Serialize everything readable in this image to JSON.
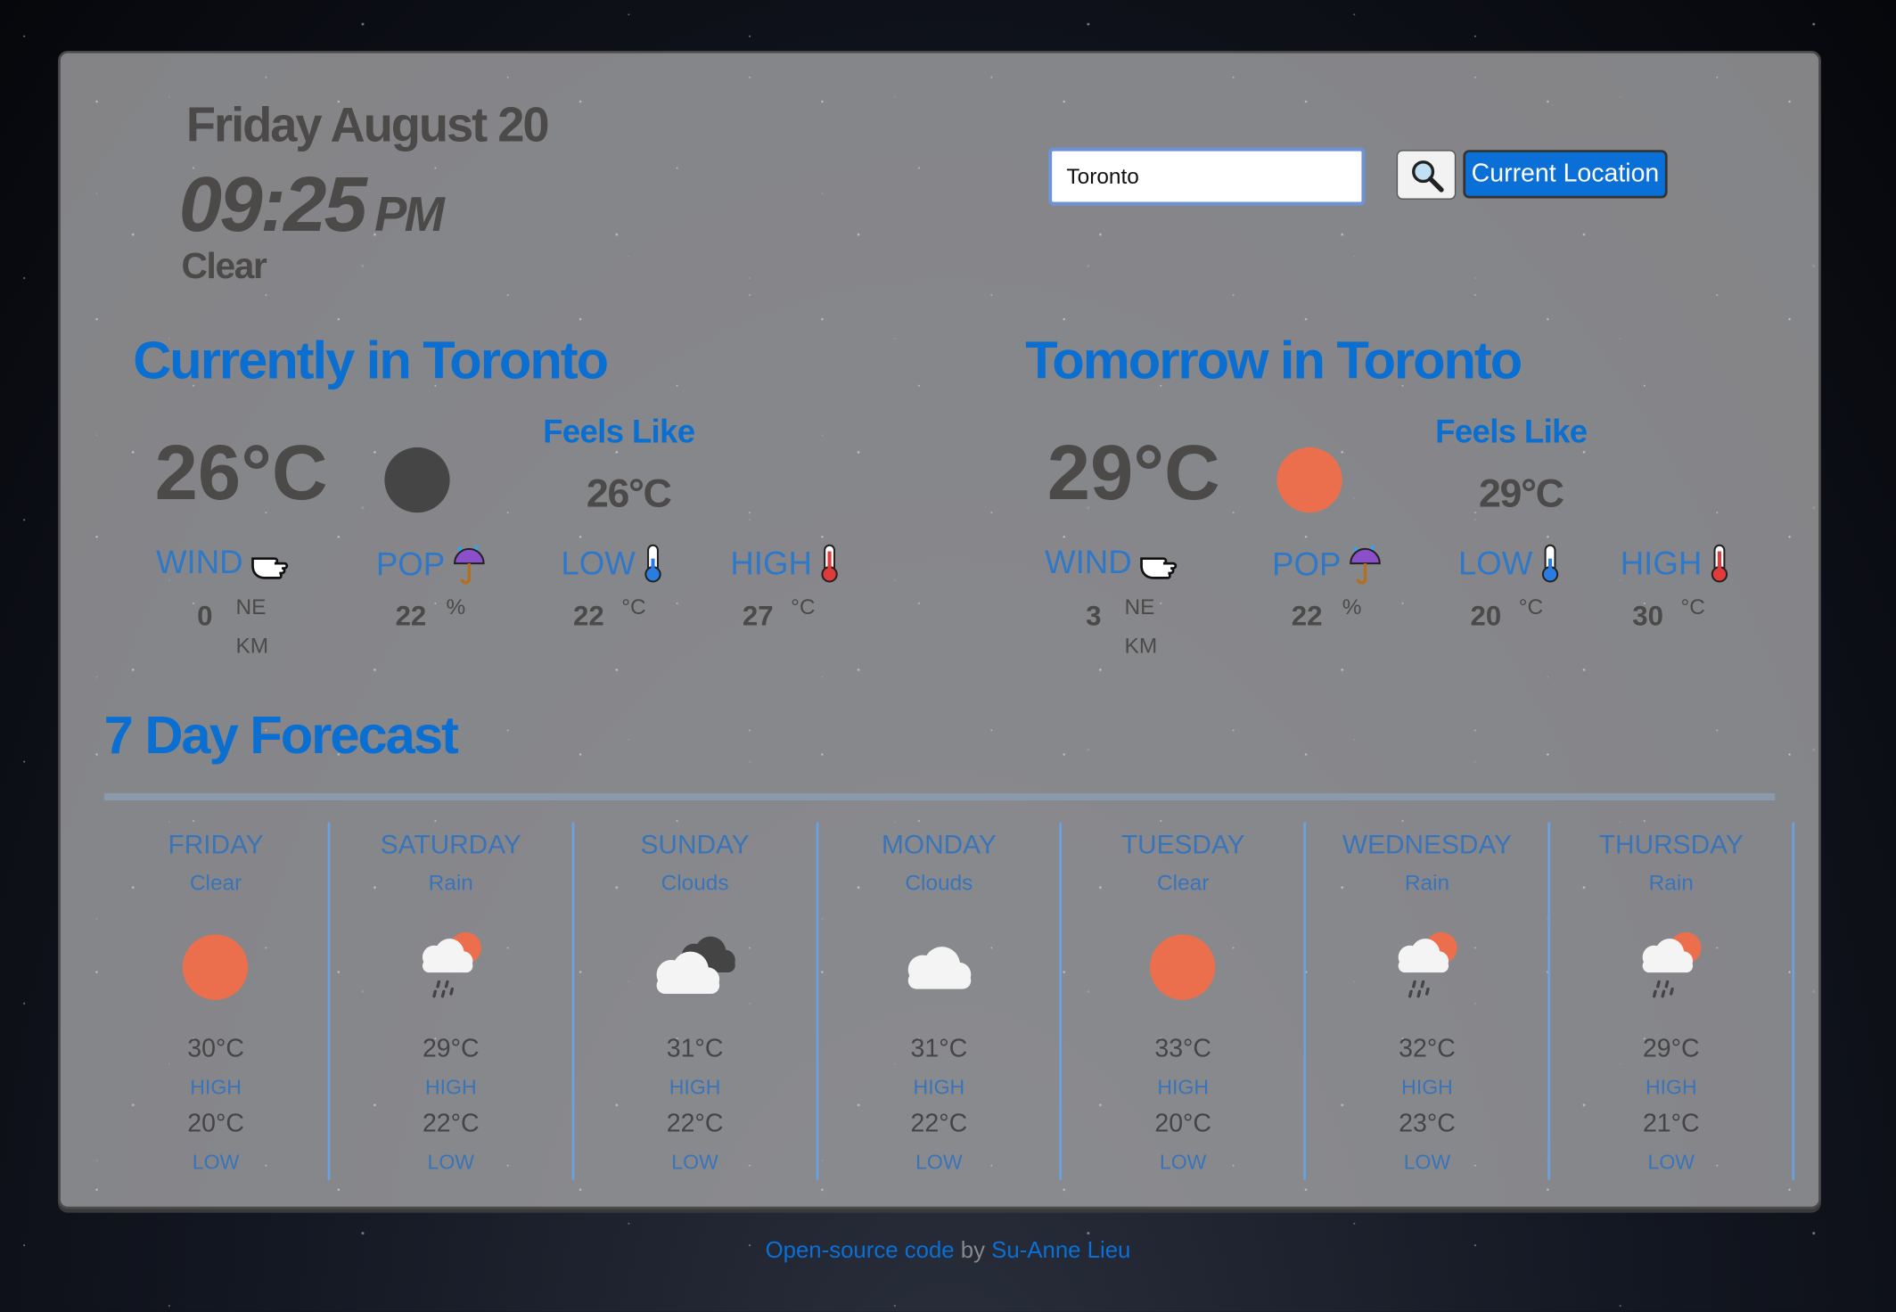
{
  "header": {
    "date": "Friday August 20",
    "time": "09:25",
    "ampm": "PM",
    "condition": "Clear"
  },
  "search": {
    "value": "Toronto",
    "button_icon": "search-icon",
    "location_label": "Current Location"
  },
  "colors": {
    "accent": "#0a6fd6",
    "sun": "#ec6f4d",
    "moon": "#454545"
  },
  "current": {
    "title": "Currently in Toronto",
    "temp": "26°C",
    "icon": "moon-icon",
    "feels_label": "Feels Like",
    "feels": "26°C",
    "wind_label": "WIND",
    "wind": "0",
    "wind_dir": "NE",
    "wind_unit": "KM",
    "pop_label": "POP",
    "pop": "22",
    "pop_unit": "%",
    "low_label": "LOW",
    "low": "22",
    "low_unit": "°C",
    "high_label": "HIGH",
    "high": "27",
    "high_unit": "°C"
  },
  "tomorrow": {
    "title": "Tomorrow in Toronto",
    "temp": "29°C",
    "icon": "sun-icon",
    "feels_label": "Feels Like",
    "feels": "29°C",
    "wind_label": "WIND",
    "wind": "3",
    "wind_dir": "NE",
    "wind_unit": "KM",
    "pop_label": "POP",
    "pop": "22",
    "pop_unit": "%",
    "low_label": "LOW",
    "low": "20",
    "low_unit": "°C",
    "high_label": "HIGH",
    "high": "30",
    "high_unit": "°C"
  },
  "forecast": {
    "title": "7 Day Forecast",
    "high_label": "HIGH",
    "low_label": "LOW",
    "days": [
      {
        "day": "FRIDAY",
        "condition": "Clear",
        "icon": "sun",
        "high": "30°C",
        "low": "20°C"
      },
      {
        "day": "SATURDAY",
        "condition": "Rain",
        "icon": "rain",
        "high": "29°C",
        "low": "22°C"
      },
      {
        "day": "SUNDAY",
        "condition": "Clouds",
        "icon": "clouds-dark",
        "high": "31°C",
        "low": "22°C"
      },
      {
        "day": "MONDAY",
        "condition": "Clouds",
        "icon": "cloud",
        "high": "31°C",
        "low": "22°C"
      },
      {
        "day": "TUESDAY",
        "condition": "Clear",
        "icon": "sun",
        "high": "33°C",
        "low": "20°C"
      },
      {
        "day": "WEDNESDAY",
        "condition": "Rain",
        "icon": "rain",
        "high": "32°C",
        "low": "23°C"
      },
      {
        "day": "THURSDAY",
        "condition": "Rain",
        "icon": "rain",
        "high": "29°C",
        "low": "21°C"
      }
    ]
  },
  "footer": {
    "code_link": "Open-source code",
    "by": " by ",
    "author_link": "Su-Anne Lieu"
  }
}
